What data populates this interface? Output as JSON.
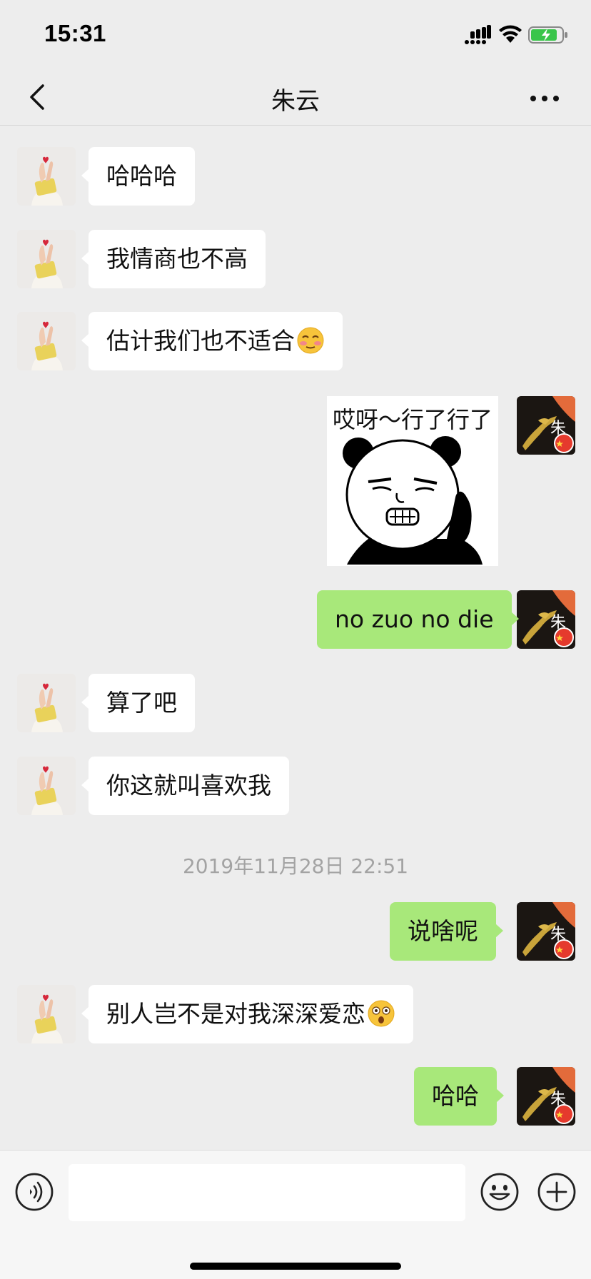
{
  "status_bar": {
    "time": "15:31"
  },
  "header": {
    "title": "朱云"
  },
  "messages": [
    {
      "sender": "contact",
      "text": "哈哈哈"
    },
    {
      "sender": "contact",
      "text": "我情商也不高"
    },
    {
      "sender": "contact",
      "text": "估计我们也不适合",
      "emoji": "flushed-face-emoji"
    },
    {
      "sender": "me",
      "type": "sticker",
      "sticker_caption": "哎呀～行了行了",
      "sticker_icon": "panda-pushing-away-sticker"
    },
    {
      "sender": "me",
      "text": "no zuo no die"
    },
    {
      "sender": "contact",
      "text": "算了吧"
    },
    {
      "sender": "contact",
      "text": "你这就叫喜欢我"
    },
    {
      "sender": "me",
      "text": "说啥呢"
    },
    {
      "sender": "contact",
      "text": "别人岂不是对我深深爱恋",
      "emoji": "astonished-face-emoji"
    },
    {
      "sender": "me",
      "text": "哈哈"
    }
  ],
  "timestamp": "2019年11月28日 22:51",
  "input_bar": {
    "value": "",
    "placeholder": ""
  },
  "colors": {
    "background": "#ededed",
    "outgoing_bubble": "#a8e87a",
    "incoming_bubble": "#ffffff",
    "timestamp": "#a3a3a3"
  }
}
